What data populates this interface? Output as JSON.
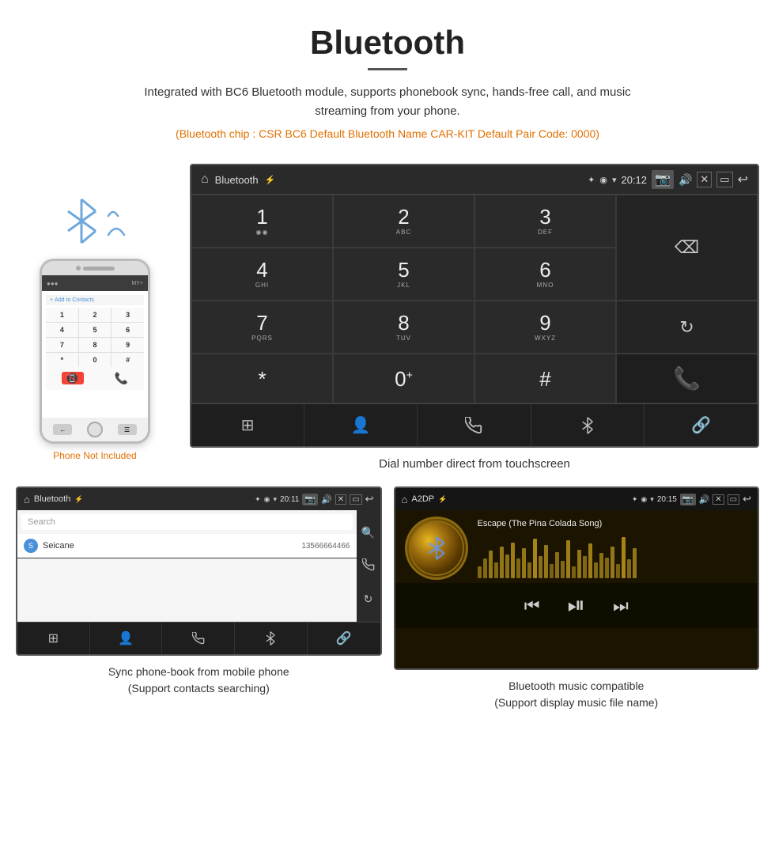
{
  "header": {
    "title": "Bluetooth",
    "subtitle": "Integrated with BC6 Bluetooth module, supports phonebook sync, hands-free call, and music streaming from your phone.",
    "info_line": "(Bluetooth chip : CSR BC6    Default Bluetooth Name CAR-KIT    Default Pair Code: 0000)"
  },
  "phone_note": "Phone Not Included",
  "dialpad_screen": {
    "title": "Bluetooth",
    "time": "20:12",
    "keys": [
      {
        "num": "1",
        "sub": ""
      },
      {
        "num": "2",
        "sub": "ABC"
      },
      {
        "num": "3",
        "sub": "DEF"
      },
      {
        "num": "4",
        "sub": "GHI"
      },
      {
        "num": "5",
        "sub": "JKL"
      },
      {
        "num": "6",
        "sub": "MNO"
      },
      {
        "num": "7",
        "sub": "PQRS"
      },
      {
        "num": "8",
        "sub": "TUV"
      },
      {
        "num": "9",
        "sub": "WXYZ"
      },
      {
        "num": "*",
        "sub": ""
      },
      {
        "num": "0",
        "sub": "+"
      },
      {
        "num": "#",
        "sub": ""
      }
    ],
    "caption": "Dial number direct from touchscreen"
  },
  "phonebook_screen": {
    "title": "Bluetooth",
    "time": "20:11",
    "search_placeholder": "Search",
    "contact": {
      "letter": "S",
      "name": "Seicane",
      "phone": "13566664466"
    },
    "caption_line1": "Sync phone-book from mobile phone",
    "caption_line2": "(Support contacts searching)"
  },
  "music_screen": {
    "title": "A2DP",
    "time": "20:15",
    "song_title": "Escape (The Pina Colada Song)",
    "caption_line1": "Bluetooth music compatible",
    "caption_line2": "(Support display music file name)"
  },
  "colors": {
    "accent_orange": "#e07000",
    "screen_bg": "#2a2a2a",
    "status_bar": "#2a2a2a",
    "grid_border": "#3a3a3a",
    "call_green": "#4caf50",
    "end_red": "#f44336"
  }
}
